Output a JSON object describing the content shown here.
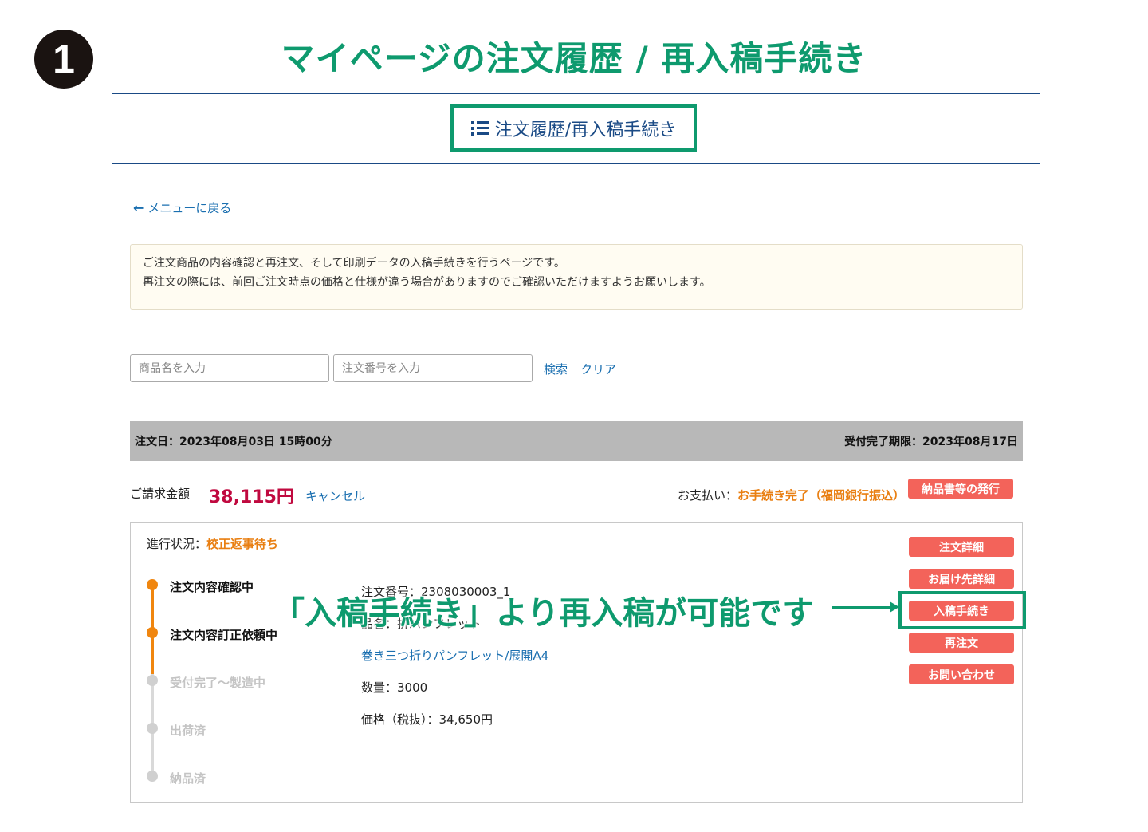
{
  "step_number": "1",
  "heading": "マイページの注文履歴 / 再入稿手続き",
  "page_tab": {
    "icon": "list-icon",
    "label": "注文履歴/再入稿手続き"
  },
  "back_link": {
    "icon": "arrow-left-icon",
    "label": "メニューに戻る"
  },
  "notice": {
    "line1": "ご注文商品の内容確認と再注文、そして印刷データの入稿手続きを行うページです。",
    "line2": "再注文の際には、前回ご注文時点の価格と仕様が違う場合がありますのでご確認いただけますようお願いします。"
  },
  "search": {
    "product_placeholder": "商品名を入力",
    "order_placeholder": "注文番号を入力",
    "search_label": "検索",
    "clear_label": "クリア"
  },
  "order": {
    "order_date": "注文日：2023年08月03日 15時00分",
    "deadline": "受付完了期限：2023年08月17日",
    "billing_label": "ご請求金額",
    "billing_amount": "38,115円",
    "cancel_label": "キャンセル",
    "payment_label": "お支払い：",
    "payment_status": "お手続き完了（福岡銀行振込）",
    "invoice_button": "納品書等の発行",
    "progress_label": "進行状況：",
    "progress_status": "校正返事待ち",
    "timeline": [
      {
        "label": "注文内容確認中",
        "state": "done"
      },
      {
        "label": "注文内容訂正依頼中",
        "state": "done"
      },
      {
        "label": "受付完了〜製造中",
        "state": "todo"
      },
      {
        "label": "出荷済",
        "state": "todo"
      },
      {
        "label": "納品済",
        "state": "todo"
      }
    ],
    "details": {
      "order_number_line": "注文番号：2308030003_1",
      "product_type_line": "品名：折パンフレット",
      "product_link": "巻き三つ折りパンフレット/展開A4",
      "quantity": "数量：3000",
      "price": "価格（税抜）：34,650円"
    },
    "actions": [
      "注文詳細",
      "お届け先詳細",
      "入稿手続き",
      "再注文",
      "お問い合わせ"
    ]
  },
  "callout": "「入稿手続き」より再入稿が可能です",
  "colors": {
    "accent_green": "#0e9a6e",
    "link_blue": "#1a6fb0",
    "button_red": "#f3635a",
    "status_orange": "#e97f12",
    "amount_red": "#c0093f"
  }
}
